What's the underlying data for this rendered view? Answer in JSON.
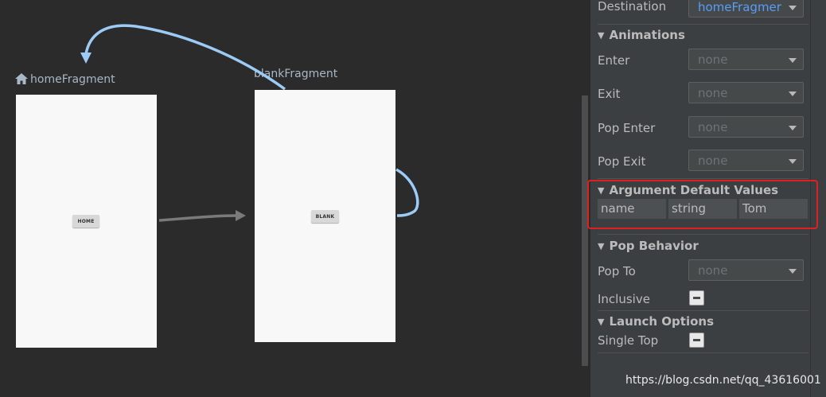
{
  "graph": {
    "home": {
      "title": "homeFragment",
      "button": "HOME",
      "is_start": true
    },
    "blank": {
      "title": "blankFragment",
      "button": "BLANK"
    }
  },
  "attributes": {
    "destination": {
      "label": "Destination",
      "value": "homeFragmer"
    },
    "animations": {
      "title": "Animations",
      "enter": {
        "label": "Enter",
        "value": "none"
      },
      "exit": {
        "label": "Exit",
        "value": "none"
      },
      "pop_enter": {
        "label": "Pop Enter",
        "value": "none"
      },
      "pop_exit": {
        "label": "Pop Exit",
        "value": "none"
      }
    },
    "argument_defaults": {
      "title": "Argument Default Values",
      "row": {
        "name": "name",
        "type": "string",
        "value": "Tom"
      }
    },
    "pop_behavior": {
      "title": "Pop Behavior",
      "pop_to": {
        "label": "Pop To",
        "value": "none"
      },
      "inclusive": {
        "label": "Inclusive"
      }
    },
    "launch_options": {
      "title": "Launch Options",
      "single_top": {
        "label": "Single Top"
      }
    }
  },
  "watermark": "https://blog.csdn.net/qq_43616001",
  "icons": {
    "home": "home-icon",
    "collapse": "triangle-down-icon",
    "dropdown": "chevron-down-icon"
  },
  "colors": {
    "accent": "#589df6",
    "action_arrow": "#9ccbf6",
    "highlight": "#e02020"
  }
}
